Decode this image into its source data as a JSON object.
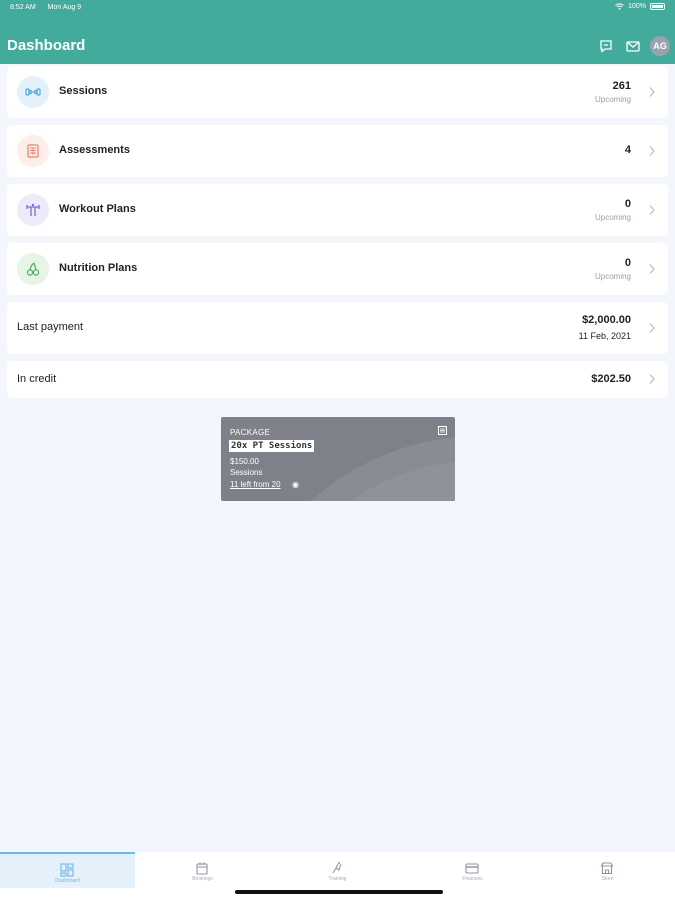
{
  "status_bar": {
    "time": "8:52 AM",
    "date": "Mon Aug 9",
    "battery": "100%"
  },
  "header": {
    "title": "Dashboard",
    "avatar_initials": "AG",
    "accent_color": "#43ab9c"
  },
  "cards": [
    {
      "label": "Sessions",
      "value": "261",
      "sub": "Upcoming",
      "icon": "dumbbell-icon",
      "icon_color": "#4fa8e0"
    },
    {
      "label": "Assessments",
      "value": "4",
      "icon": "clipboard-icon",
      "icon_color": "#e8826a"
    },
    {
      "label": "Workout Plans",
      "value": "0",
      "sub": "Upcoming",
      "icon": "workout-icon",
      "icon_color": "#7a6ad8"
    },
    {
      "label": "Nutrition Plans",
      "value": "0",
      "sub": "Upcoming",
      "icon": "cherries-icon",
      "icon_color": "#4fae5f"
    }
  ],
  "last_payment": {
    "label": "Last payment",
    "amount": "$2,000.00",
    "date": "11 Feb, 2021"
  },
  "credit": {
    "label": "In credit",
    "amount": "$202.50"
  },
  "package": {
    "type": "PACKAGE",
    "name": "20x PT Sessions",
    "price": "$150.00",
    "unit": "Sessions",
    "remaining": "11 left from 20"
  },
  "tabs": [
    {
      "label": "Dashboard",
      "icon": "dashboard-icon",
      "active": true
    },
    {
      "label": "Bookings",
      "icon": "calendar-icon"
    },
    {
      "label": "Training",
      "icon": "training-icon"
    },
    {
      "label": "Finances",
      "icon": "card-icon"
    },
    {
      "label": "Store",
      "icon": "store-icon"
    }
  ]
}
